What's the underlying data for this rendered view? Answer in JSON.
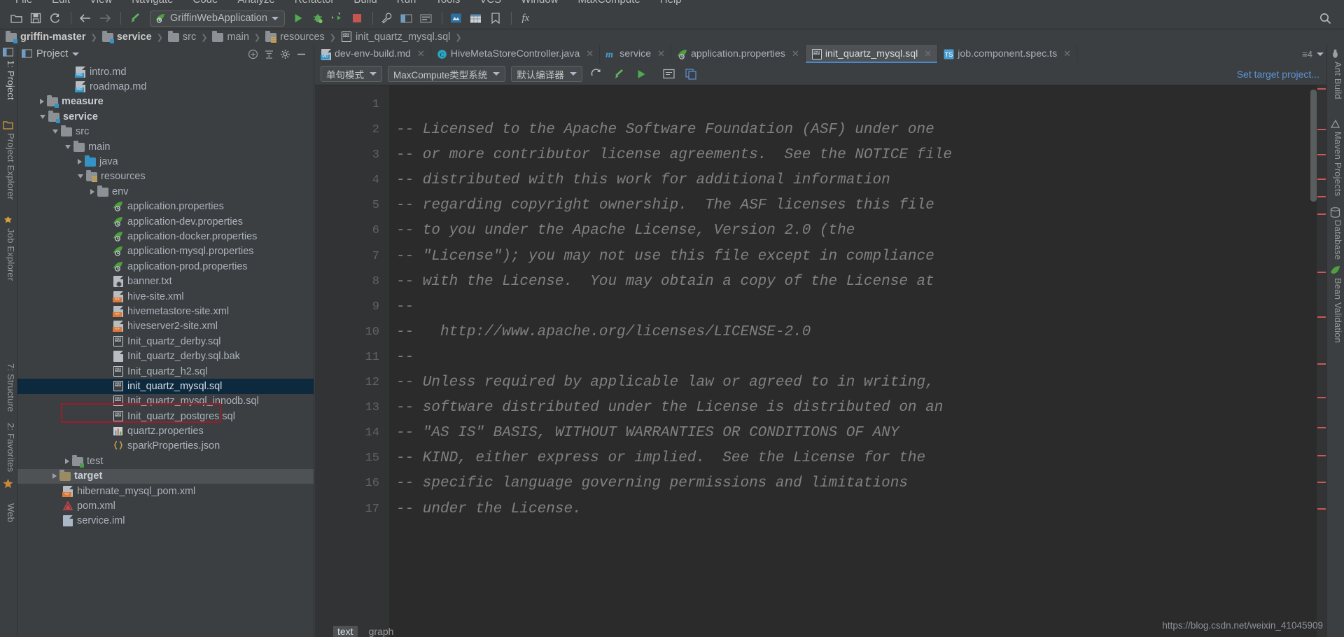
{
  "menu": {
    "items": [
      "File",
      "Edit",
      "View",
      "Navigate",
      "Code",
      "Analyze",
      "Refactor",
      "Build",
      "Run",
      "Tools",
      "VCS",
      "Window",
      "MaxCompute",
      "Help"
    ]
  },
  "toolbar": {
    "icons": [
      "open-folder-icon",
      "save-all-icon",
      "sync-icon",
      "back-arrow-icon",
      "forward-arrow-icon",
      "compile-icon"
    ],
    "run_config": "GriffinWebApplication",
    "run_icons": [
      "run-icon",
      "debug-icon",
      "run-with-coverage-icon",
      "stop-icon",
      "build-icon",
      "settings-icon",
      "project-structure-icon",
      "terminal-icon",
      "maxcompute-icon",
      "database-icon",
      "bookmark-icon",
      "fx-icon"
    ],
    "search_icon": "search-icon"
  },
  "breadcrumb": [
    {
      "label": "griffin-master",
      "icon": "module-folder-icon",
      "bold": true
    },
    {
      "label": "service",
      "icon": "module-folder-icon",
      "bold": true
    },
    {
      "label": "src",
      "icon": "folder-icon",
      "bold": false
    },
    {
      "label": "main",
      "icon": "folder-icon",
      "bold": false
    },
    {
      "label": "resources",
      "icon": "resources-folder-icon",
      "bold": false
    },
    {
      "label": "init_quartz_mysql.sql",
      "icon": "sql-file-icon",
      "bold": false
    }
  ],
  "left_tool_window": {
    "tabs": [
      {
        "label": "1: Project",
        "icon": "project-icon"
      },
      {
        "label": "Project Explorer",
        "icon": "explorer-icon"
      },
      {
        "label": "Job Explorer",
        "icon": "job-icon"
      },
      {
        "label": "7: Structure",
        "icon": "structure-icon"
      },
      {
        "label": "2: Favorites",
        "icon": "favorites-icon"
      },
      {
        "label": "Web",
        "icon": "web-icon"
      }
    ]
  },
  "right_tool_window": {
    "tabs": [
      {
        "label": "Ant Build",
        "icon": "ant-icon"
      },
      {
        "label": "Maven Projects",
        "icon": "maven-icon"
      },
      {
        "label": "Database",
        "icon": "database-icon"
      },
      {
        "label": "Bean Validation",
        "icon": "bean-icon"
      }
    ]
  },
  "project_panel": {
    "title": "Project",
    "title_caret": "chevron-down-icon",
    "actions": [
      "collapse-all-icon",
      "expand-all-icon",
      "settings-gear-icon",
      "hide-icon"
    ],
    "tree": [
      {
        "label": "intro.md",
        "indent": 3,
        "arrow": "none",
        "icon": "markdown-file-icon",
        "bold": false,
        "selected": false
      },
      {
        "label": "roadmap.md",
        "indent": 3,
        "arrow": "none",
        "icon": "markdown-file-icon",
        "bold": false,
        "selected": false
      },
      {
        "label": "measure",
        "indent": 1,
        "arrow": "closed",
        "icon": "module-folder-icon",
        "bold": true,
        "selected": false
      },
      {
        "label": "service",
        "indent": 1,
        "arrow": "open",
        "icon": "module-folder-icon",
        "bold": true,
        "selected": false
      },
      {
        "label": "src",
        "indent": 2,
        "arrow": "open",
        "icon": "folder-icon",
        "bold": false,
        "selected": false
      },
      {
        "label": "main",
        "indent": 3,
        "arrow": "open",
        "icon": "folder-icon",
        "bold": false,
        "selected": false
      },
      {
        "label": "java",
        "indent": 4,
        "arrow": "closed",
        "icon": "source-folder-icon",
        "bold": false,
        "selected": false
      },
      {
        "label": "resources",
        "indent": 4,
        "arrow": "open",
        "icon": "resources-folder-icon",
        "bold": false,
        "selected": false
      },
      {
        "label": "env",
        "indent": 5,
        "arrow": "closed",
        "icon": "folder-icon",
        "bold": false,
        "selected": false
      },
      {
        "label": "application.properties",
        "indent": 6,
        "arrow": "none",
        "icon": "spring-file-icon",
        "bold": false,
        "selected": false
      },
      {
        "label": "application-dev.properties",
        "indent": 6,
        "arrow": "none",
        "icon": "spring-file-icon",
        "bold": false,
        "selected": false
      },
      {
        "label": "application-docker.properties",
        "indent": 6,
        "arrow": "none",
        "icon": "spring-file-icon",
        "bold": false,
        "selected": false
      },
      {
        "label": "application-mysql.properties",
        "indent": 6,
        "arrow": "none",
        "icon": "spring-file-icon",
        "bold": false,
        "selected": false
      },
      {
        "label": "application-prod.properties",
        "indent": 6,
        "arrow": "none",
        "icon": "spring-file-icon",
        "bold": false,
        "selected": false
      },
      {
        "label": "banner.txt",
        "indent": 6,
        "arrow": "none",
        "icon": "text-file-icon",
        "bold": false,
        "selected": false
      },
      {
        "label": "hive-site.xml",
        "indent": 6,
        "arrow": "none",
        "icon": "xml-file-icon",
        "bold": false,
        "selected": false
      },
      {
        "label": "hivemetastore-site.xml",
        "indent": 6,
        "arrow": "none",
        "icon": "xml-file-icon",
        "bold": false,
        "selected": false
      },
      {
        "label": "hiveserver2-site.xml",
        "indent": 6,
        "arrow": "none",
        "icon": "xml-file-icon",
        "bold": false,
        "selected": false
      },
      {
        "label": "Init_quartz_derby.sql",
        "indent": 6,
        "arrow": "none",
        "icon": "sql-file-icon",
        "bold": false,
        "selected": false
      },
      {
        "label": "Init_quartz_derby.sql.bak",
        "indent": 6,
        "arrow": "none",
        "icon": "plain-file-icon",
        "bold": false,
        "selected": false
      },
      {
        "label": "Init_quartz_h2.sql",
        "indent": 6,
        "arrow": "none",
        "icon": "sql-file-icon",
        "bold": false,
        "selected": false
      },
      {
        "label": "init_quartz_mysql.sql",
        "indent": 6,
        "arrow": "none",
        "icon": "sql-file-icon",
        "bold": false,
        "selected": true
      },
      {
        "label": "Init_quartz_mysql_innodb.sql",
        "indent": 6,
        "arrow": "none",
        "icon": "sql-file-icon",
        "bold": false,
        "selected": false
      },
      {
        "label": "Init_quartz_postgres.sql",
        "indent": 6,
        "arrow": "none",
        "icon": "sql-file-icon",
        "bold": false,
        "selected": false
      },
      {
        "label": "quartz.properties",
        "indent": 6,
        "arrow": "none",
        "icon": "properties-file-icon",
        "bold": false,
        "selected": false
      },
      {
        "label": "sparkProperties.json",
        "indent": 6,
        "arrow": "none",
        "icon": "json-file-icon",
        "bold": false,
        "selected": false
      },
      {
        "label": "test",
        "indent": 3,
        "arrow": "closed",
        "icon": "test-folder-icon",
        "bold": false,
        "selected": false
      },
      {
        "label": "target",
        "indent": 2,
        "arrow": "closed",
        "icon": "excluded-folder-icon",
        "bold": true,
        "selected": false,
        "target": true
      },
      {
        "label": "hibernate_mysql_pom.xml",
        "indent": 2,
        "arrow": "none",
        "icon": "xml-file-icon",
        "bold": false,
        "selected": false
      },
      {
        "label": "pom.xml",
        "indent": 2,
        "arrow": "none",
        "icon": "maven-file-icon",
        "bold": false,
        "selected": false
      },
      {
        "label": "service.iml",
        "indent": 2,
        "arrow": "none",
        "icon": "iml-file-icon",
        "bold": false,
        "selected": false
      }
    ]
  },
  "editor_tabs": [
    {
      "label": "dev-env-build.md",
      "icon": "markdown-file-icon",
      "active": false,
      "closable": true
    },
    {
      "label": "HiveMetaStoreController.java",
      "icon": "java-class-icon",
      "active": false,
      "closable": true
    },
    {
      "label": "service",
      "icon": "maven-module-icon",
      "active": false,
      "closable": true
    },
    {
      "label": "application.properties",
      "icon": "spring-file-icon",
      "active": false,
      "closable": true
    },
    {
      "label": "init_quartz_mysql.sql",
      "icon": "sql-file-icon",
      "active": true,
      "closable": true
    },
    {
      "label": "job.component.spec.ts",
      "icon": "typescript-file-icon",
      "active": false,
      "closable": true
    }
  ],
  "editor_tabs_right": {
    "overflow": "≡4",
    "overflow_icon": "tab-overflow-icon"
  },
  "sql_toolbar": {
    "combos": [
      {
        "label": "单句模式",
        "caret": "chevron-down-icon"
      },
      {
        "label": "MaxCompute类型系统",
        "caret": "chevron-down-icon"
      },
      {
        "label": "默认编译器",
        "caret": "chevron-down-icon"
      }
    ],
    "icons": [
      "refresh-icon",
      "compile-icon",
      "run-icon",
      "format-icon",
      "copy-icon"
    ],
    "set_target_link": "Set target project..."
  },
  "code": {
    "language": "sql",
    "lines": [
      {
        "n": "1",
        "text": ""
      },
      {
        "n": "2",
        "text": "-- Licensed to the Apache Software Foundation (ASF) under one"
      },
      {
        "n": "3",
        "text": "-- or more contributor license agreements.  See the NOTICE file"
      },
      {
        "n": "4",
        "text": "-- distributed with this work for additional information"
      },
      {
        "n": "5",
        "text": "-- regarding copyright ownership.  The ASF licenses this file"
      },
      {
        "n": "6",
        "text": "-- to you under the Apache License, Version 2.0 (the"
      },
      {
        "n": "7",
        "text": "-- \"License\"); you may not use this file except in compliance"
      },
      {
        "n": "8",
        "text": "-- with the License.  You may obtain a copy of the License at"
      },
      {
        "n": "9",
        "text": "--"
      },
      {
        "n": "10",
        "text": "--   http://www.apache.org/licenses/LICENSE-2.0"
      },
      {
        "n": "11",
        "text": "--"
      },
      {
        "n": "12",
        "text": "-- Unless required by applicable law or agreed to in writing,"
      },
      {
        "n": "13",
        "text": "-- software distributed under the License is distributed on an"
      },
      {
        "n": "14",
        "text": "-- \"AS IS\" BASIS, WITHOUT WARRANTIES OR CONDITIONS OF ANY"
      },
      {
        "n": "15",
        "text": "-- KIND, either express or implied.  See the License for the"
      },
      {
        "n": "16",
        "text": "-- specific language governing permissions and limitations"
      },
      {
        "n": "17",
        "text": "-- under the License."
      }
    ]
  },
  "bottom_tabs": [
    {
      "label": "text",
      "selected": true
    },
    {
      "label": "graph",
      "selected": false
    }
  ],
  "watermark": "https://blog.csdn.net/weixin_41045909",
  "colors": {
    "background": "#3c3f41",
    "editor_background": "#2b2b2b",
    "selection": "#0d293e",
    "accent_blue": "#4a88c7",
    "comment_gray": "#808080",
    "link_blue": "#5b93d6",
    "highlight_red": "#9b1c2c"
  }
}
